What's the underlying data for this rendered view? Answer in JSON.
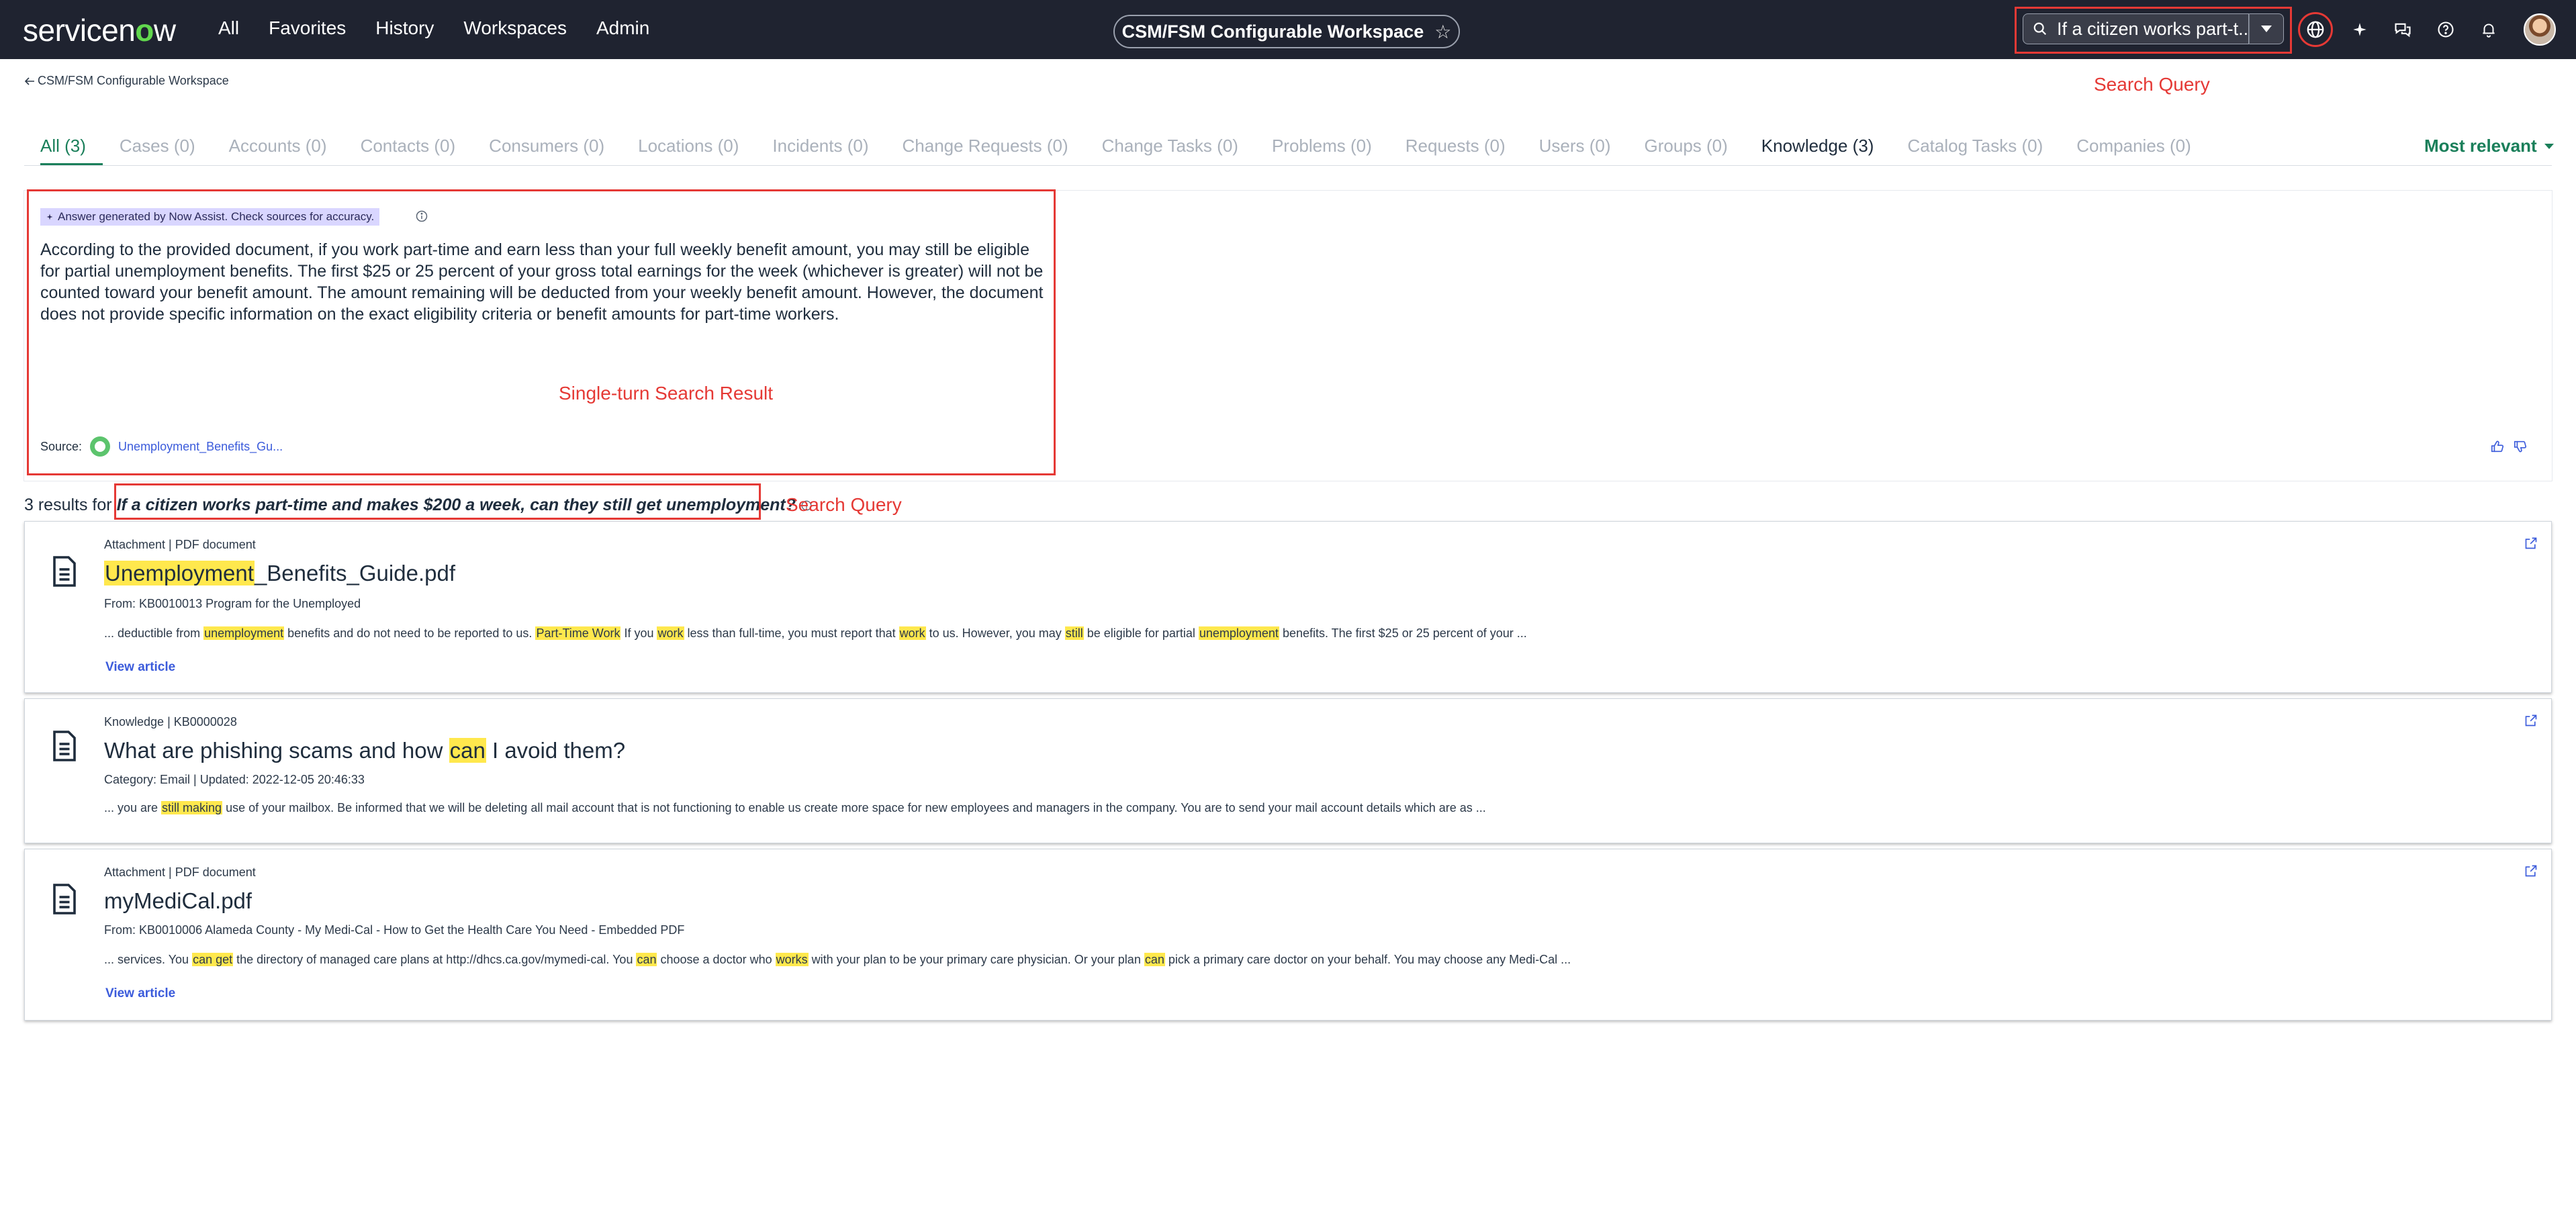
{
  "topbar": {
    "logo_pre": "servicen",
    "logo_ow": "o",
    "logo_post": "w",
    "nav": [
      "All",
      "Favorites",
      "History",
      "Workspaces",
      "Admin"
    ],
    "workspace": "CSM/FSM Configurable Workspace",
    "search_value": "If a citizen works part-t...",
    "icons": [
      "globe-icon",
      "sparkle-icon",
      "chat-icon",
      "help-icon",
      "bell-icon",
      "avatar"
    ]
  },
  "breadcrumb": {
    "label": "CSM/FSM Configurable Workspace"
  },
  "annotations": {
    "top_search": "Search Query",
    "answer": "Single-turn Search Result",
    "results_query": "Search Query"
  },
  "tabs": [
    {
      "label": "All (3)",
      "state": "active"
    },
    {
      "label": "Cases (0)",
      "state": "disabled"
    },
    {
      "label": "Accounts (0)",
      "state": "disabled"
    },
    {
      "label": "Contacts (0)",
      "state": "disabled"
    },
    {
      "label": "Consumers (0)",
      "state": "disabled"
    },
    {
      "label": "Locations (0)",
      "state": "disabled"
    },
    {
      "label": "Incidents (0)",
      "state": "disabled"
    },
    {
      "label": "Change Requests (0)",
      "state": "disabled"
    },
    {
      "label": "Change Tasks (0)",
      "state": "disabled"
    },
    {
      "label": "Problems (0)",
      "state": "disabled"
    },
    {
      "label": "Requests (0)",
      "state": "disabled"
    },
    {
      "label": "Users (0)",
      "state": "disabled"
    },
    {
      "label": "Groups (0)",
      "state": "disabled"
    },
    {
      "label": "Knowledge (3)",
      "state": "normal"
    },
    {
      "label": "Catalog Tasks (0)",
      "state": "disabled"
    },
    {
      "label": "Companies (0)",
      "state": "disabled"
    }
  ],
  "sort": {
    "label": "Most relevant"
  },
  "answer": {
    "badge": "Answer generated by Now Assist. Check sources for accuracy.",
    "text": "According to the provided document, if you work part-time and earn less than your full weekly benefit amount, you may still be eligible for partial unemployment benefits. The first $25 or 25 percent of your gross total earnings for the week (whichever is greater) will not be counted toward your benefit amount. The amount remaining will be deducted from your weekly benefit amount. However, the document does not provide specific information on the exact eligibility criteria or benefit amounts for part-time workers.",
    "source_label": "Source:",
    "source_link": "Unemployment_Benefits_Gu..."
  },
  "results": {
    "count_prefix": "3 results for",
    "query": "If a citizen works part-time and makes $200 a week, can they still get unemployment?",
    "items": [
      {
        "meta": "Attachment | PDF document",
        "title_hl": "Unemployment",
        "title_rest": "_Benefits_Guide.pdf",
        "sub": "From: KB0010013 Program for the Unemployed",
        "snippet": [
          {
            "t": "... deductible from "
          },
          {
            "h": "unemployment"
          },
          {
            "t": " benefits and do not need to be reported to us. "
          },
          {
            "h": "Part-Time Work"
          },
          {
            "t": " If you "
          },
          {
            "h": "work"
          },
          {
            "t": " less than full-time, you must report that "
          },
          {
            "h": "work"
          },
          {
            "t": " to us. However, you may "
          },
          {
            "h": "still"
          },
          {
            "t": " be eligible for partial "
          },
          {
            "h": "unemployment"
          },
          {
            "t": " benefits. The first $25 or 25 percent of your ..."
          }
        ],
        "view": "View article"
      },
      {
        "meta": "Knowledge | KB0000028",
        "title_pre": "What are phishing scams and how ",
        "title_hl": "can",
        "title_rest": " I avoid them?",
        "sub": "Category: Email | Updated: 2022-12-05 20:46:33",
        "snippet": [
          {
            "t": "... you are "
          },
          {
            "h": "still making"
          },
          {
            "t": " use of your mailbox. Be informed that we will be deleting all mail account that is not functioning to enable us create more space for new employees and managers in the company. You are to send your mail account details which are as ..."
          }
        ]
      },
      {
        "meta": "Attachment | PDF document",
        "title_rest": "myMediCal.pdf",
        "sub": "From: KB0010006 Alameda County - My Medi-Cal - How to Get the Health Care You Need - Embedded PDF",
        "snippet": [
          {
            "t": "... services. You "
          },
          {
            "h": "can get"
          },
          {
            "t": " the directory of managed care plans at http://dhcs.ca.gov/mymedi-cal. You "
          },
          {
            "h": "can"
          },
          {
            "t": " choose a doctor who "
          },
          {
            "h": "works"
          },
          {
            "t": " with your plan to be your primary care physician. Or your plan "
          },
          {
            "h": "can"
          },
          {
            "t": " pick a primary care doctor on your behalf. You may choose any Medi-Cal ..."
          }
        ],
        "view": "View article"
      }
    ]
  },
  "colors": {
    "topbar": "#1f2330",
    "accent": "#1a7f5a",
    "annotation": "#e53935",
    "highlight": "#ffe84d",
    "link": "#3b5bdb"
  }
}
